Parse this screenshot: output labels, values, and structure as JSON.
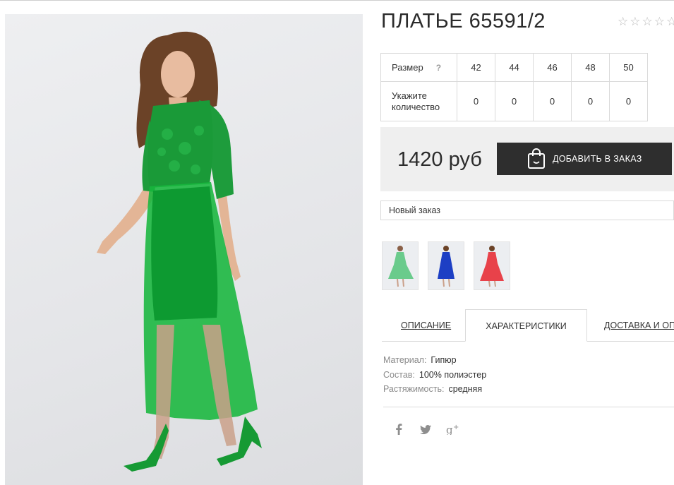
{
  "product": {
    "title": "ПЛАТЬЕ 65591/2",
    "rating": {
      "value": 0,
      "max": 5
    },
    "price": "1420 руб",
    "order_button": "ДОБАВИТЬ В ЗАКАЗ",
    "order_select": "Новый заказ"
  },
  "sizes": {
    "size_label": "Размер",
    "help": "?",
    "qty_label_1": "Укажите",
    "qty_label_2": "количество",
    "items": [
      {
        "size": "42",
        "qty": "0"
      },
      {
        "size": "44",
        "qty": "0"
      },
      {
        "size": "46",
        "qty": "0"
      },
      {
        "size": "48",
        "qty": "0"
      },
      {
        "size": "50",
        "qty": "0"
      }
    ]
  },
  "thumbnails": [
    {
      "name": "green",
      "color": "#3fbf6a"
    },
    {
      "name": "blue",
      "color": "#1d3fc4"
    },
    {
      "name": "red",
      "color": "#e8232d"
    }
  ],
  "tabs": {
    "description": "ОПИСАНИЕ",
    "characteristics": "ХАРАКТЕРИСТИКИ",
    "delivery": "ДОСТАВКА И ОПЛАТА",
    "active": "characteristics"
  },
  "specs": [
    {
      "key": "Материал:",
      "value": "Гипюр"
    },
    {
      "key": "Состав:",
      "value": "100% полиэстер"
    },
    {
      "key": "Растяжимость:",
      "value": "средняя"
    }
  ],
  "social": [
    "facebook-icon",
    "twitter-icon",
    "google-plus-icon"
  ],
  "colors": {
    "dress": "#19a23a",
    "button": "#2e2e2e",
    "price_bg": "#efefef"
  }
}
